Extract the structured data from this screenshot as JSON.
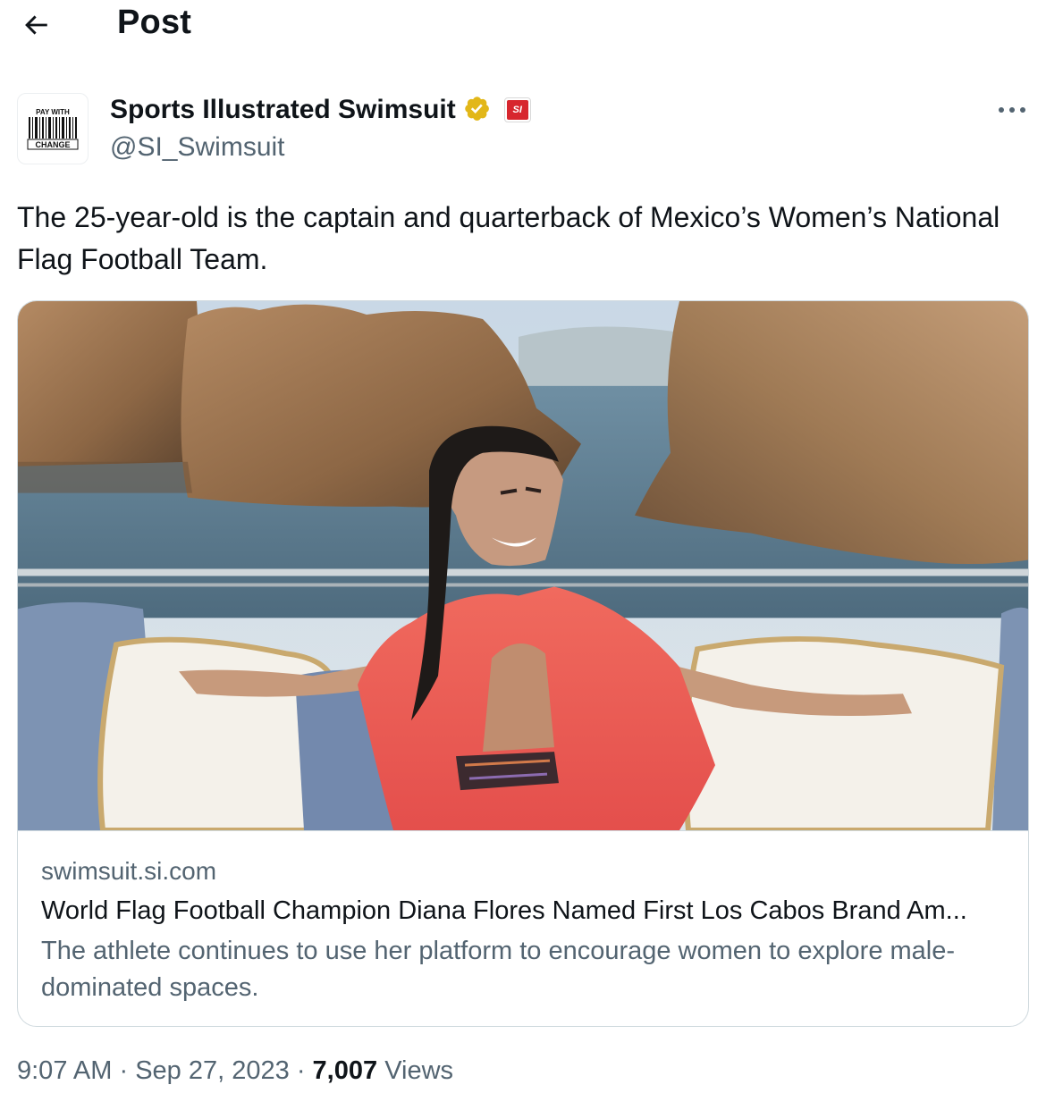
{
  "header": {
    "title": "Post",
    "back_icon": "arrow-left-icon"
  },
  "author": {
    "name": "Sports Illustrated Swimsuit",
    "handle": "@SI_Swimsuit",
    "avatar_text_top": "PAY WITH",
    "avatar_text_bottom": "CHANGE",
    "verified_color": "#e2b719",
    "affiliate_badge_text": "SI",
    "more_icon": "more-horizontal-icon",
    "more_label": "•••"
  },
  "tweet": {
    "text": "The 25-year-old is the captain and quarterback of Mexico’s Women’s National Flag Football Team."
  },
  "card": {
    "image": "photo-woman-on-boat-with-rock-formations",
    "domain": "swimsuit.si.com",
    "title": "World Flag Football Champion Diana Flores Named First Los Cabos Brand Am...",
    "description": "The athlete continues to use her platform to encourage women to explore male-dominated spaces."
  },
  "meta": {
    "time": "9:07 AM",
    "separator": "·",
    "date": "Sep 27, 2023",
    "views_count": "7,007",
    "views_label": "Views"
  },
  "colors": {
    "text_primary": "#0f1419",
    "text_secondary": "#536471",
    "border": "#cfd9de",
    "si_red": "#d7262e"
  }
}
